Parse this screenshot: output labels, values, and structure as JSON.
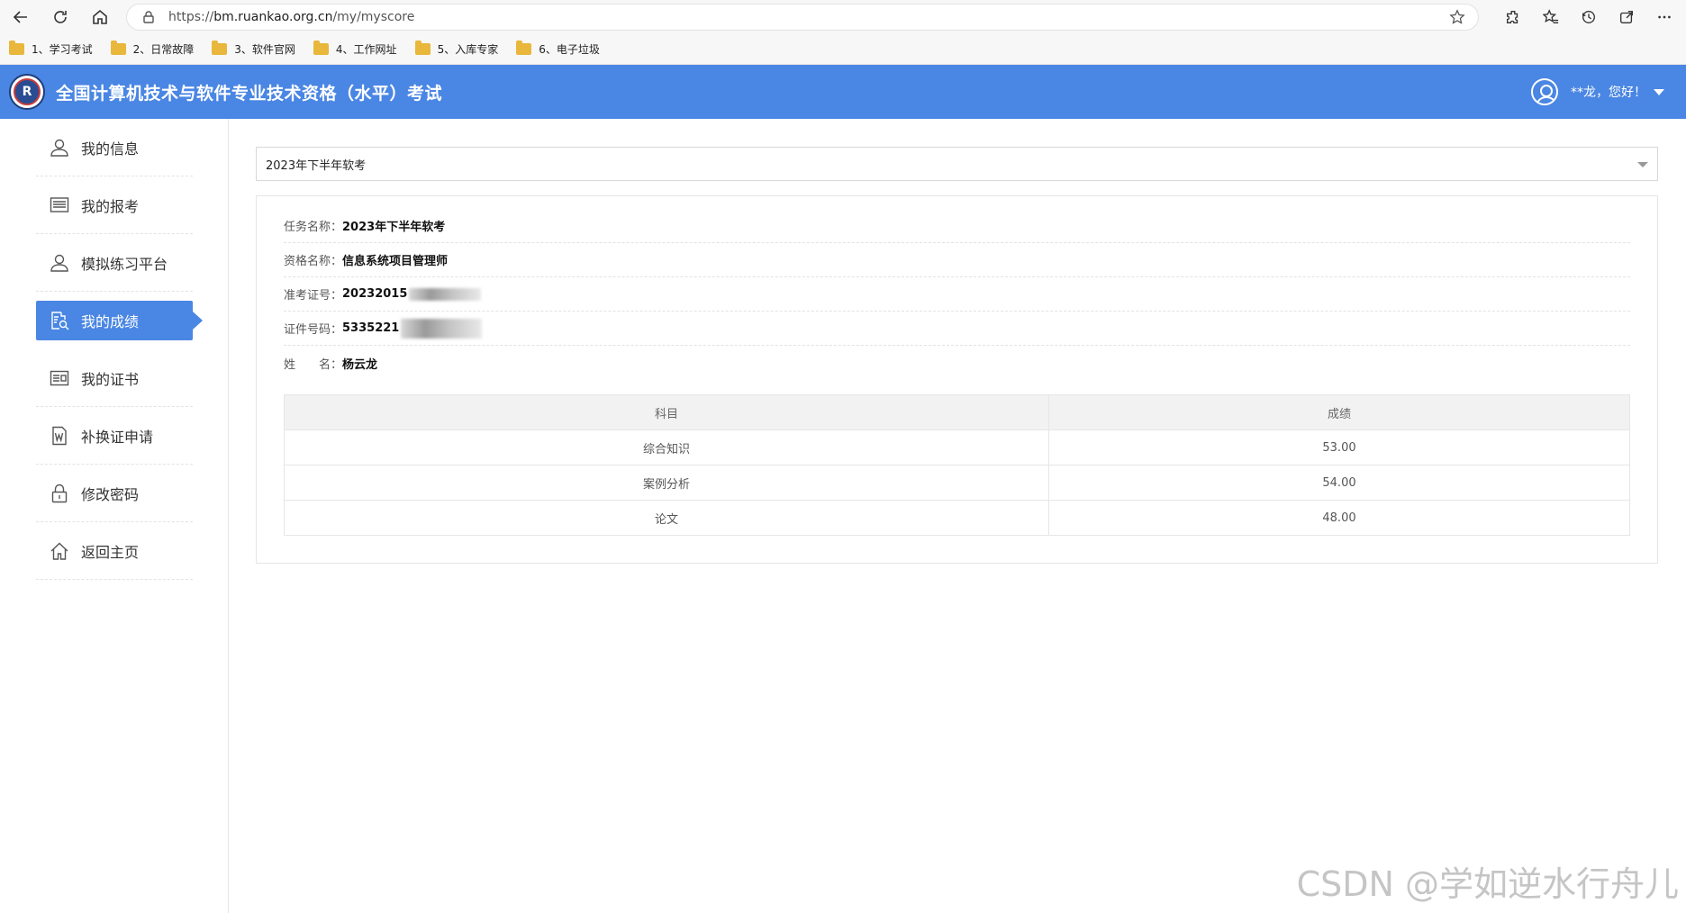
{
  "browser": {
    "url_scheme": "https://",
    "url_host": "bm.ruankao.org.cn",
    "url_path": "/my/myscore"
  },
  "bookmarks": [
    {
      "label": "1、学习考试"
    },
    {
      "label": "2、日常故障"
    },
    {
      "label": "3、软件官网"
    },
    {
      "label": "4、工作网址"
    },
    {
      "label": "5、入库专家"
    },
    {
      "label": "6、电子垃圾"
    }
  ],
  "header": {
    "logo_text": "R",
    "title": "全国计算机技术与软件专业技术资格（水平）考试",
    "user_greeting": "**龙，您好！"
  },
  "sidebar": {
    "items": [
      {
        "label": "我的信息",
        "icon": "user-icon"
      },
      {
        "label": "我的报考",
        "icon": "list-icon"
      },
      {
        "label": "模拟练习平台",
        "icon": "user-icon"
      },
      {
        "label": "我的成绩",
        "icon": "score-search-icon",
        "active": true
      },
      {
        "label": "我的证书",
        "icon": "certificate-icon"
      },
      {
        "label": "补换证申请",
        "icon": "word-doc-icon"
      },
      {
        "label": "修改密码",
        "icon": "lock-icon"
      },
      {
        "label": "返回主页",
        "icon": "home-icon"
      }
    ]
  },
  "main": {
    "exam_select": "2023年下半年软考",
    "info": {
      "task_label": "任务名称：",
      "task_value": "2023年下半年软考",
      "qual_label": "资格名称：",
      "qual_value": "信息系统项目管理师",
      "ticket_label": "准考证号：",
      "ticket_value": "20232015",
      "id_label": "证件号码：",
      "id_value": "5335221",
      "name_label": "姓　　名：",
      "name_value": "杨云龙"
    },
    "table": {
      "headers": [
        "科目",
        "成绩"
      ],
      "rows": [
        [
          "综合知识",
          "53.00"
        ],
        [
          "案例分析",
          "54.00"
        ],
        [
          "论文",
          "48.00"
        ]
      ]
    }
  },
  "watermark": "CSDN @学如逆水行舟儿",
  "colors": {
    "brand_blue": "#4a86e3"
  }
}
